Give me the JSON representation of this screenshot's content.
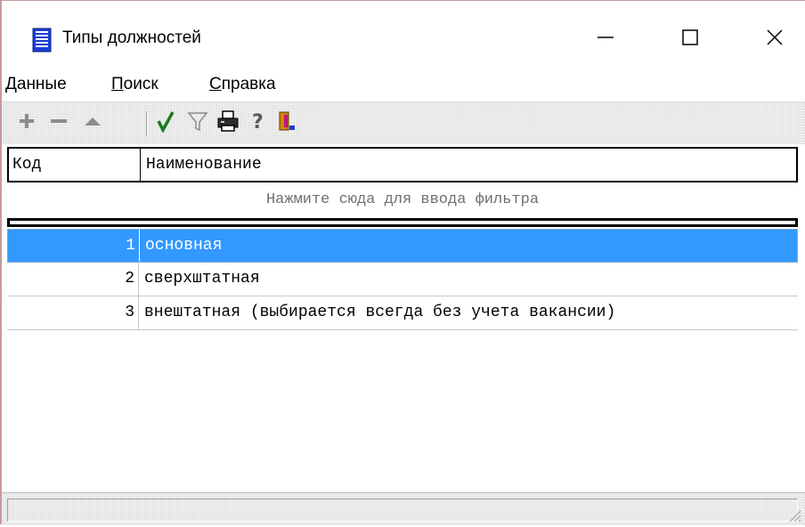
{
  "window": {
    "title": "Типы должностей",
    "icon": "document-list-icon",
    "controls": [
      "minimize-icon",
      "maximize-icon",
      "close-icon"
    ]
  },
  "menu": [
    {
      "label": "Данные",
      "accel": "Д",
      "rest": "анные"
    },
    {
      "label": "Поиск",
      "accel": "П",
      "rest": "оиск"
    },
    {
      "label": "Справка",
      "accel": "С",
      "rest": "правка"
    }
  ],
  "toolbar": {
    "buttons": [
      {
        "icon": "add-icon",
        "enabled": false
      },
      {
        "icon": "remove-icon",
        "enabled": false
      },
      {
        "icon": "move-up-icon",
        "enabled": false
      },
      {
        "icon": "checkmark-icon",
        "enabled": true
      },
      {
        "icon": "filter-icon",
        "enabled": false
      },
      {
        "icon": "printer-icon",
        "enabled": true
      },
      {
        "icon": "help-icon",
        "enabled": true
      },
      {
        "icon": "exit-icon",
        "enabled": true
      }
    ]
  },
  "grid": {
    "columns": [
      "Код",
      "Наименование"
    ],
    "filter_placeholder": "Нажмите сюда для ввода фильтра",
    "rows": [
      {
        "code": "1",
        "name": "основная",
        "selected": true
      },
      {
        "code": "2",
        "name": "сверхштатная",
        "selected": false
      },
      {
        "code": "3",
        "name": "внештатная (выбирается всегда без учета вакансии)",
        "selected": false
      }
    ]
  },
  "colors": {
    "selection": "#3399ff",
    "icon_blue": "#1a3fd6",
    "check_green": "#1b7a1b"
  }
}
